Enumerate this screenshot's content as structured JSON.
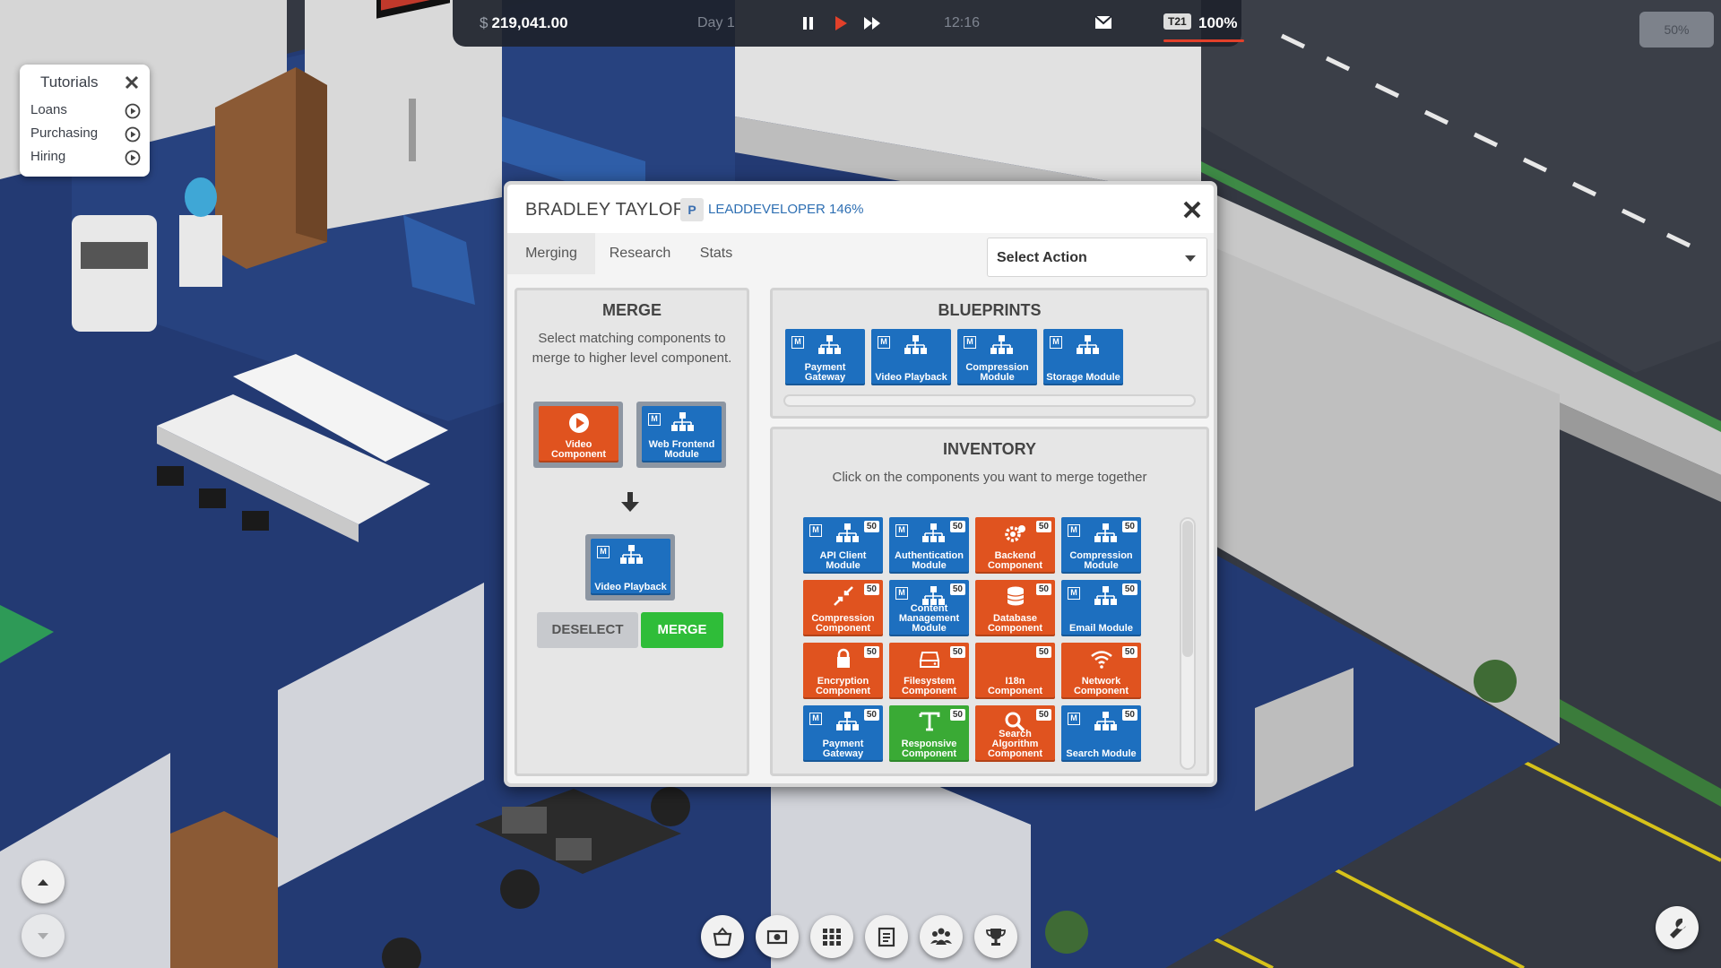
{
  "topbar": {
    "currency_symbol": "$",
    "money": "219,041.00",
    "day": "Day 1",
    "time": "12:16",
    "team_badge": "T21",
    "team_percent": "100%"
  },
  "zoom_level": "50%",
  "tutorials": {
    "title": "Tutorials",
    "items": [
      {
        "label": "Loans"
      },
      {
        "label": "Purchasing"
      },
      {
        "label": "Hiring"
      }
    ]
  },
  "dialog": {
    "employee_name": "BRADLEY TAYLOR",
    "role_icon_letter": "P",
    "role": "LEADDEVELOPER 146%",
    "tabs": [
      {
        "label": "Merging",
        "active": true
      },
      {
        "label": "Research",
        "active": false
      },
      {
        "label": "Stats",
        "active": false
      }
    ],
    "action_select": {
      "value": "Select Action"
    },
    "merge": {
      "title": "MERGE",
      "description": "Select matching components to merge to higher level component.",
      "inputs": [
        {
          "label": "Video Component",
          "kind": "component",
          "icon": "play-icon"
        },
        {
          "label": "Web Frontend Module",
          "kind": "module",
          "icon": "hierarchy-icon"
        }
      ],
      "result": {
        "label": "Video Playback",
        "kind": "module",
        "icon": "hierarchy-icon"
      },
      "deselect_label": "DESELECT",
      "merge_label": "MERGE"
    },
    "blueprints": {
      "title": "BLUEPRINTS",
      "items": [
        {
          "label": "Payment Gateway"
        },
        {
          "label": "Video Playback"
        },
        {
          "label": "Compression Module"
        },
        {
          "label": "Storage Module"
        }
      ]
    },
    "inventory": {
      "title": "INVENTORY",
      "description": "Click on the components you want to merge together",
      "items": [
        {
          "label": "API Client Module",
          "qty": "50",
          "kind": "module",
          "icon": "hierarchy-icon"
        },
        {
          "label": "Authentication Module",
          "qty": "50",
          "kind": "module",
          "icon": "hierarchy-icon"
        },
        {
          "label": "Backend Component",
          "qty": "50",
          "kind": "component",
          "icon": "gears-icon"
        },
        {
          "label": "Compression Module",
          "qty": "50",
          "kind": "module",
          "icon": "hierarchy-icon"
        },
        {
          "label": "Compression Component",
          "qty": "50",
          "kind": "component",
          "icon": "compress-icon"
        },
        {
          "label": "Content Management Module",
          "qty": "50",
          "kind": "module",
          "icon": "hierarchy-icon"
        },
        {
          "label": "Database Component",
          "qty": "50",
          "kind": "component",
          "icon": "database-icon"
        },
        {
          "label": "Email Module",
          "qty": "50",
          "kind": "module",
          "icon": "hierarchy-icon"
        },
        {
          "label": "Encryption Component",
          "qty": "50",
          "kind": "component",
          "icon": "lock-icon"
        },
        {
          "label": "Filesystem Component",
          "qty": "50",
          "kind": "component",
          "icon": "drive-icon"
        },
        {
          "label": "I18n Component",
          "qty": "50",
          "kind": "component",
          "icon": "none"
        },
        {
          "label": "Network Component",
          "qty": "50",
          "kind": "component",
          "icon": "wifi-icon"
        },
        {
          "label": "Payment Gateway",
          "qty": "50",
          "kind": "module",
          "icon": "hierarchy-icon"
        },
        {
          "label": "Responsive Component",
          "qty": "50",
          "kind": "ui",
          "icon": "text-icon"
        },
        {
          "label": "Search Algorithm Component",
          "qty": "50",
          "kind": "component",
          "icon": "search-icon"
        },
        {
          "label": "Search Module",
          "qty": "50",
          "kind": "module",
          "icon": "hierarchy-icon"
        }
      ]
    }
  },
  "colors": {
    "module": "#1d6fbf",
    "component": "#e0531f",
    "ui_component": "#3aaa35",
    "merge_button": "#2fbd39",
    "role_text": "#2e6fb3"
  },
  "bottom_toolbar": [
    {
      "icon": "basket-icon"
    },
    {
      "icon": "money-icon"
    },
    {
      "icon": "grid-icon"
    },
    {
      "icon": "clipboard-icon"
    },
    {
      "icon": "team-icon"
    },
    {
      "icon": "trophy-icon"
    }
  ]
}
